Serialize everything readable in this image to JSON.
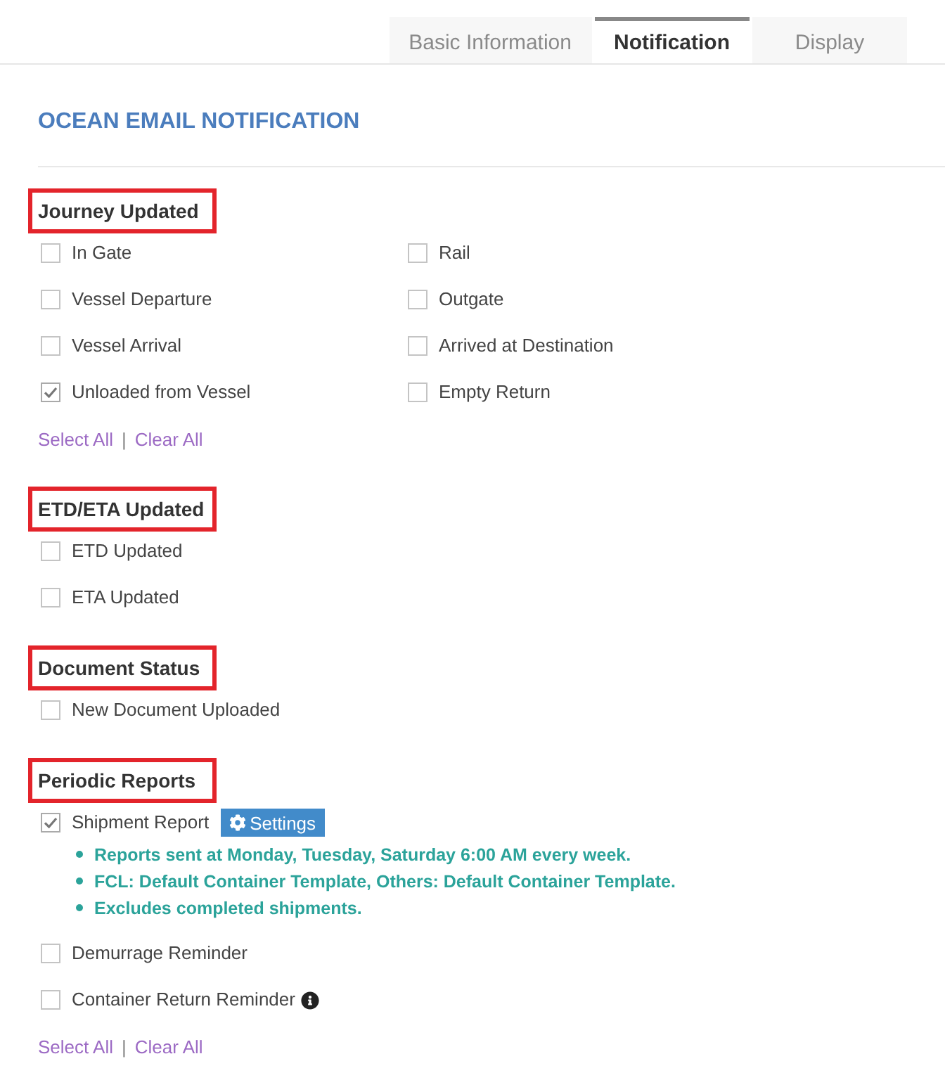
{
  "tabs": [
    {
      "label": "Basic Information",
      "selected": false
    },
    {
      "label": "Notification",
      "selected": true
    },
    {
      "label": "Display",
      "selected": false
    }
  ],
  "page_title": "OCEAN EMAIL NOTIFICATION",
  "sections": [
    {
      "heading": "Journey Updated",
      "highlighted": true,
      "columns": [
        {
          "options": [
            {
              "label": "In Gate",
              "checked": false
            },
            {
              "label": "Vessel Departure",
              "checked": false
            },
            {
              "label": "Vessel Arrival",
              "checked": false
            },
            {
              "label": "Unloaded from Vessel",
              "checked": true
            }
          ]
        },
        {
          "options": [
            {
              "label": "Rail",
              "checked": false
            },
            {
              "label": "Outgate",
              "checked": false
            },
            {
              "label": "Arrived at Destination",
              "checked": false
            },
            {
              "label": "Empty Return",
              "checked": false
            }
          ]
        }
      ],
      "links": [
        "Select All",
        "Clear All"
      ],
      "link_separator": "|"
    },
    {
      "heading": "ETD/ETA Updated",
      "highlighted": true,
      "columns": [
        {
          "options": [
            {
              "label": "ETD Updated",
              "checked": false
            },
            {
              "label": "ETA Updated",
              "checked": false
            }
          ]
        }
      ]
    },
    {
      "heading": "Document Status",
      "highlighted": true,
      "columns": [
        {
          "options": [
            {
              "label": "New Document Uploaded",
              "checked": false
            }
          ]
        }
      ]
    },
    {
      "heading": "Periodic Reports",
      "highlighted": true,
      "columns": [
        {
          "options": [
            {
              "label": "Shipment Report",
              "checked": true,
              "button": {
                "label": "Settings"
              },
              "notes": [
                "Reports sent at Monday, Tuesday, Saturday 6:00 AM every week.",
                "FCL: Default Container Template, Others: Default Container Template.",
                "Excludes completed shipments."
              ]
            },
            {
              "label": "Demurrage Reminder",
              "checked": false
            },
            {
              "label": "Container Return Reminder",
              "checked": false,
              "info": true
            }
          ]
        }
      ],
      "links": [
        "Select All",
        "Clear All"
      ],
      "link_separator": "|"
    }
  ]
}
